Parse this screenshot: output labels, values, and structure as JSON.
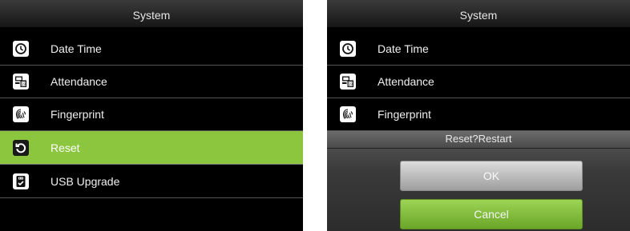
{
  "left_screen": {
    "title": "System",
    "items": [
      {
        "label": "Date Time",
        "icon": "clock-icon"
      },
      {
        "label": "Attendance",
        "icon": "calendar-icon"
      },
      {
        "label": "Fingerprint",
        "icon": "fingerprint-icon"
      },
      {
        "label": "Reset",
        "icon": "reset-icon",
        "selected": true
      },
      {
        "label": "USB Upgrade",
        "icon": "usb-upgrade-icon"
      }
    ]
  },
  "right_screen": {
    "title": "System",
    "items": [
      {
        "label": "Date Time",
        "icon": "clock-icon"
      },
      {
        "label": "Attendance",
        "icon": "calendar-icon"
      },
      {
        "label": "Fingerprint",
        "icon": "fingerprint-icon"
      }
    ],
    "dialog": {
      "title": "Reset?Restart",
      "ok_label": "OK",
      "cancel_label": "Cancel"
    }
  },
  "colors": {
    "selected_row": "#8cc63f",
    "screen_background": "#000000",
    "cancel_button": "#7fbf3a",
    "ok_button": "#c0c0c0"
  }
}
